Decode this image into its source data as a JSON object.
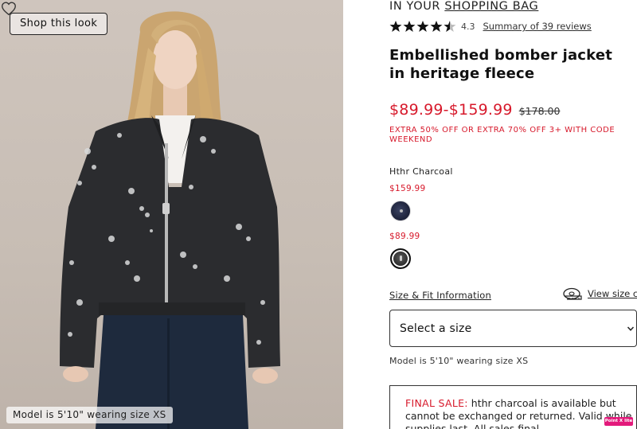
{
  "image_panel": {
    "shop_look_label": "Shop this look",
    "model_caption": "Model is 5'10\" wearing size XS"
  },
  "header": {
    "bag_prefix": "IN YOUR",
    "bag_link": "SHOPPING BAG"
  },
  "rating": {
    "value": "4.3",
    "stars_out_of_5": 4.3,
    "reviews_link": "Summary of 39 reviews"
  },
  "product": {
    "title": "Embellished bomber jacket in heritage fleece",
    "price_range": "$89.99-$159.99",
    "original_price": "$178.00",
    "promo": "EXTRA 50% OFF OR EXTRA 70% OFF 3+ WITH CODE WEEKEND",
    "color_name": "Hthr Charcoal",
    "swatches": [
      {
        "price": "$159.99",
        "color": "#1c2138"
      },
      {
        "price": "$89.99",
        "color": "#2a2a2a"
      }
    ]
  },
  "size": {
    "fit_link": "Size & Fit Information",
    "chart_link": "View size ch",
    "select_placeholder": "Select a size",
    "model_note": "Model is 5'10\" wearing size XS"
  },
  "final_sale": {
    "label": "FINAL SALE:",
    "text": " hthr charcoal is available but cannot be exchanged or returned. Valid while supplies last. All sales final."
  },
  "badge": {
    "text": "Point X lite"
  },
  "colors": {
    "sale_red": "#d7192b",
    "text": "#222222"
  }
}
